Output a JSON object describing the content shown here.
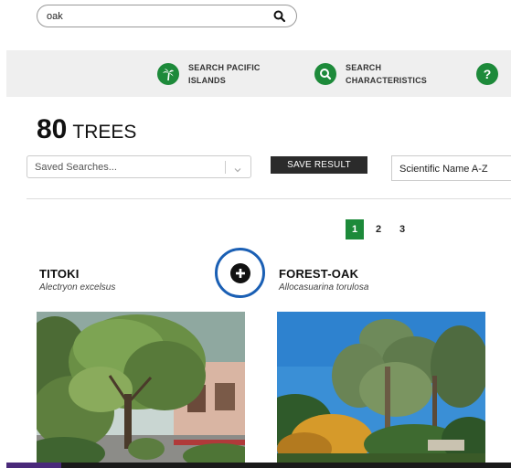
{
  "search": {
    "value": "oak",
    "icon": "search-icon"
  },
  "nav": {
    "items": [
      {
        "line1": "SEARCH PACIFIC",
        "line2": "ISLANDS",
        "icon": "palm-tree-icon"
      },
      {
        "line1": "SEARCH",
        "line2": "CHARACTERISTICS",
        "icon": "search-icon"
      },
      {
        "line1": "",
        "line2": "",
        "icon": "help-icon",
        "glyph": "?"
      }
    ],
    "accent": "#1d8a3a"
  },
  "results": {
    "count": "80",
    "label": "TREES"
  },
  "controls": {
    "saved_placeholder": "Saved Searches...",
    "save_label": "SAVE RESULT",
    "sort_value": "Scientific Name A-Z"
  },
  "pagination": {
    "pages": [
      "1",
      "2",
      "3"
    ],
    "active": "1"
  },
  "trees": [
    {
      "common": "TITOKI",
      "scientific": "Alectryon excelsus"
    },
    {
      "common": "FOREST-OAK",
      "scientific": "Allocasuarina torulosa"
    }
  ],
  "compare": {
    "icon": "add-circle-icon",
    "ring_color": "#1a5fb4"
  }
}
